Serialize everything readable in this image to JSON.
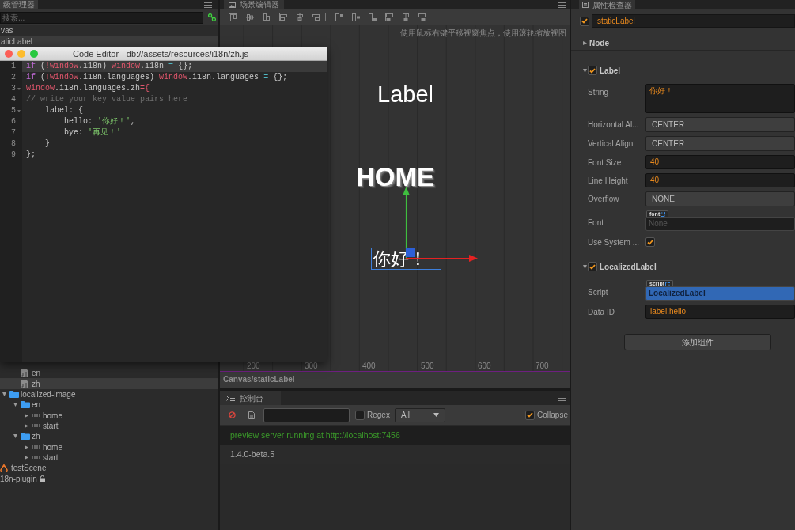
{
  "hierarchy": {
    "title": "级管理器",
    "search": {
      "placeholder": "搜索..."
    },
    "nodes": [
      {
        "label": "vas",
        "selected": false
      },
      {
        "label": "aticLabel",
        "selected": true
      }
    ]
  },
  "code_editor": {
    "title": "Code Editor - db://assets/resources/i18n/zh.js",
    "lines": [
      {
        "number": "1",
        "current": true,
        "foldable": false,
        "tokens": [
          {
            "text": "if",
            "kind": "keyword"
          },
          {
            "text": " (",
            "kind": "text"
          },
          {
            "text": "!",
            "kind": "operator"
          },
          {
            "text": "window",
            "kind": "global"
          },
          {
            "text": ".i18n) ",
            "kind": "text"
          },
          {
            "text": "window",
            "kind": "global"
          },
          {
            "text": ".i18n ",
            "kind": "text"
          },
          {
            "text": "=",
            "kind": "assign"
          },
          {
            "text": " {};",
            "kind": "text"
          }
        ]
      },
      {
        "number": "2",
        "current": false,
        "foldable": false,
        "tokens": [
          {
            "text": "if",
            "kind": "keyword"
          },
          {
            "text": " (",
            "kind": "text"
          },
          {
            "text": "!",
            "kind": "operator"
          },
          {
            "text": "window",
            "kind": "global"
          },
          {
            "text": ".i18n.languages) ",
            "kind": "text"
          },
          {
            "text": "window",
            "kind": "global"
          },
          {
            "text": ".i18n.languages ",
            "kind": "text"
          },
          {
            "text": "=",
            "kind": "assign"
          },
          {
            "text": " {};",
            "kind": "text"
          }
        ]
      },
      {
        "number": "3",
        "current": false,
        "foldable": true,
        "tokens": [
          {
            "text": "window",
            "kind": "global"
          },
          {
            "text": ".i18n.languages.zh",
            "kind": "text"
          },
          {
            "text": "={",
            "kind": "operator"
          }
        ]
      },
      {
        "number": "4",
        "current": false,
        "foldable": false,
        "tokens": [
          {
            "text": "// write your key value pairs here",
            "kind": "comment"
          }
        ]
      },
      {
        "number": "5",
        "current": false,
        "foldable": true,
        "tokens": [
          {
            "text": "    label: {",
            "kind": "text"
          }
        ]
      },
      {
        "number": "6",
        "current": false,
        "foldable": false,
        "tokens": [
          {
            "text": "        hello: ",
            "kind": "text"
          },
          {
            "text": "'你好！'",
            "kind": "string"
          },
          {
            "text": ",",
            "kind": "text"
          }
        ]
      },
      {
        "number": "7",
        "current": false,
        "foldable": false,
        "tokens": [
          {
            "text": "        bye: ",
            "kind": "text"
          },
          {
            "text": "'再见！'",
            "kind": "string"
          }
        ]
      },
      {
        "number": "8",
        "current": false,
        "foldable": false,
        "tokens": [
          {
            "text": "    }",
            "kind": "text"
          }
        ]
      },
      {
        "number": "9",
        "current": false,
        "foldable": false,
        "tokens": [
          {
            "text": "};",
            "kind": "text"
          }
        ]
      }
    ]
  },
  "assets": {
    "tree": [
      {
        "children": [
          {
            "children": [
              {
                "children": [
                  {
                    "label": "en",
                    "kind": "script",
                    "selected": false
                  },
                  {
                    "label": "zh",
                    "kind": "script",
                    "selected": true
                  }
                ]
              },
              {
                "label": "localized-image",
                "kind": "folder",
                "expanded": true,
                "selected": false,
                "children": [
                  {
                    "label": "en",
                    "kind": "folder",
                    "expanded": true,
                    "selected": false,
                    "children": [
                      {
                        "label": "home",
                        "kind": "image",
                        "expanded": false,
                        "selected": false
                      },
                      {
                        "label": "start",
                        "kind": "image",
                        "expanded": false,
                        "selected": false
                      }
                    ]
                  },
                  {
                    "label": "zh",
                    "kind": "folder",
                    "expanded": true,
                    "selected": false,
                    "children": [
                      {
                        "label": "home",
                        "kind": "image",
                        "expanded": false,
                        "selected": false
                      },
                      {
                        "label": "start",
                        "kind": "image",
                        "expanded": false,
                        "selected": false
                      }
                    ]
                  }
                ]
              }
            ]
          },
          {
            "label": "testScene",
            "kind": "scene",
            "selected": false
          }
        ]
      },
      {
        "label": "18n-plugin",
        "locked": true,
        "selected": false
      }
    ]
  },
  "scene_editor": {
    "title": "场景编辑器",
    "hint": "使用鼠标右键平移视窗焦点，使用滚轮缩放视图",
    "nodes": [
      {
        "text": "Label",
        "kind": "label",
        "selected": false
      },
      {
        "text": "HOME",
        "kind": "sprite",
        "selected": false
      },
      {
        "text": "你好！",
        "kind": "label",
        "selected": true
      }
    ],
    "ruler_labels": [
      "200",
      "300",
      "400",
      "500",
      "600",
      "700"
    ],
    "breadcrumb": "Canvas/staticLabel"
  },
  "console": {
    "title": "控制台",
    "regex": {
      "label": "Regex",
      "checked": false
    },
    "level_filter": "All",
    "collapse": {
      "label": "Collapse",
      "checked": true
    },
    "logs": [
      {
        "text": "preview server running at http://localhost:7456",
        "kind": "success"
      },
      {
        "text": "1.4.0-beta.5",
        "kind": "log"
      }
    ]
  },
  "inspector": {
    "title": "属性检查器",
    "node": {
      "name": "staticLabel",
      "active": true
    },
    "sections": [
      {
        "title": "Node",
        "kind": "node",
        "expanded": false
      },
      {
        "title": "Label",
        "kind": "component",
        "expanded": true,
        "enabled": true,
        "props": [
          {
            "label": "String",
            "kind": "textarea",
            "value": "你好！"
          },
          {
            "label": "Horizontal Al...",
            "kind": "select",
            "value": "CENTER"
          },
          {
            "label": "Vertical Align",
            "kind": "select",
            "value": "CENTER"
          },
          {
            "label": "Font Size",
            "kind": "number",
            "value": "40"
          },
          {
            "label": "Line Height",
            "kind": "number",
            "value": "40"
          },
          {
            "label": "Overflow",
            "kind": "select",
            "value": "NONE"
          },
          {
            "label": "Font",
            "kind": "asset",
            "asset_type": "font",
            "placeholder": "None"
          },
          {
            "label": "Use System ...",
            "kind": "checkbox",
            "checked": true
          }
        ]
      },
      {
        "title": "LocalizedLabel",
        "kind": "component",
        "expanded": true,
        "enabled": true,
        "props": [
          {
            "label": "Script",
            "kind": "asset",
            "asset_type": "script",
            "value": "LocalizedLabel"
          },
          {
            "label": "Data ID",
            "kind": "text",
            "value": "label.hello"
          }
        ]
      }
    ],
    "add_component": "添加组件"
  }
}
